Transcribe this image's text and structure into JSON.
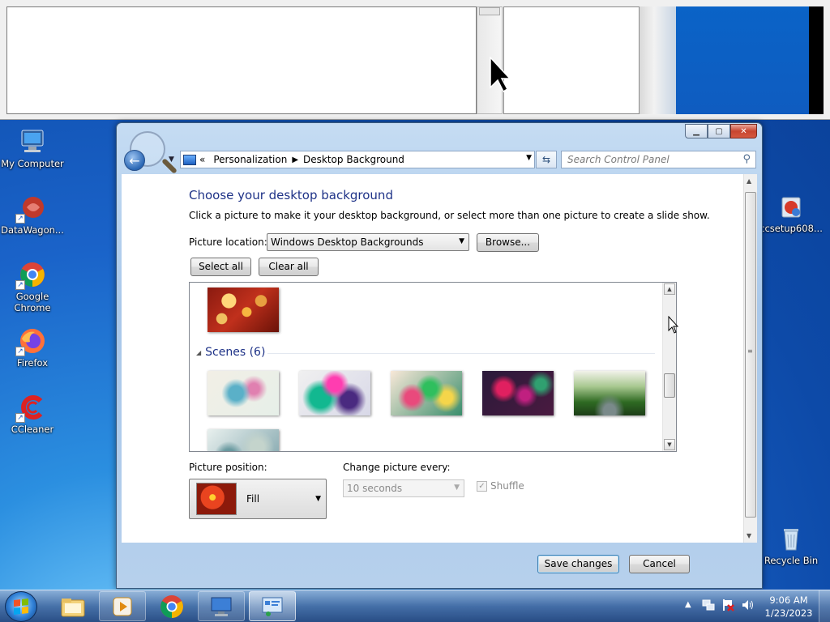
{
  "desktop": {
    "icons": [
      {
        "label": "My Computer"
      },
      {
        "label": "DataWagon..."
      },
      {
        "label": "Google Chrome"
      },
      {
        "label": "Firefox"
      },
      {
        "label": "CCleaner"
      },
      {
        "label": "ccsetup608..."
      },
      {
        "label": "Recycle Bin"
      }
    ]
  },
  "window": {
    "breadcrumb": [
      "Personalization",
      "Desktop Background"
    ],
    "breadcrumb_prefix": "«",
    "search_placeholder": "Search Control Panel",
    "title": "Choose your desktop background",
    "description": "Click a picture to make it your desktop background, or select more than one picture to create a slide show.",
    "picture_location_label": "Picture location:",
    "picture_location_value": "Windows Desktop Backgrounds",
    "browse_label": "Browse...",
    "select_all_label": "Select all",
    "clear_all_label": "Clear all",
    "group_label": "Scenes (6)",
    "picture_position_label": "Picture position:",
    "picture_position_value": "Fill",
    "change_every_label": "Change picture every:",
    "change_every_value": "10 seconds",
    "shuffle_label": "Shuffle",
    "shuffle_checked": true,
    "save_label": "Save changes",
    "cancel_label": "Cancel"
  },
  "taskbar": {
    "clock_time": "9:06 AM",
    "clock_date": "1/23/2023",
    "apps": [
      "explorer",
      "media-player",
      "chrome",
      "remote-desktop",
      "control-panel"
    ]
  }
}
